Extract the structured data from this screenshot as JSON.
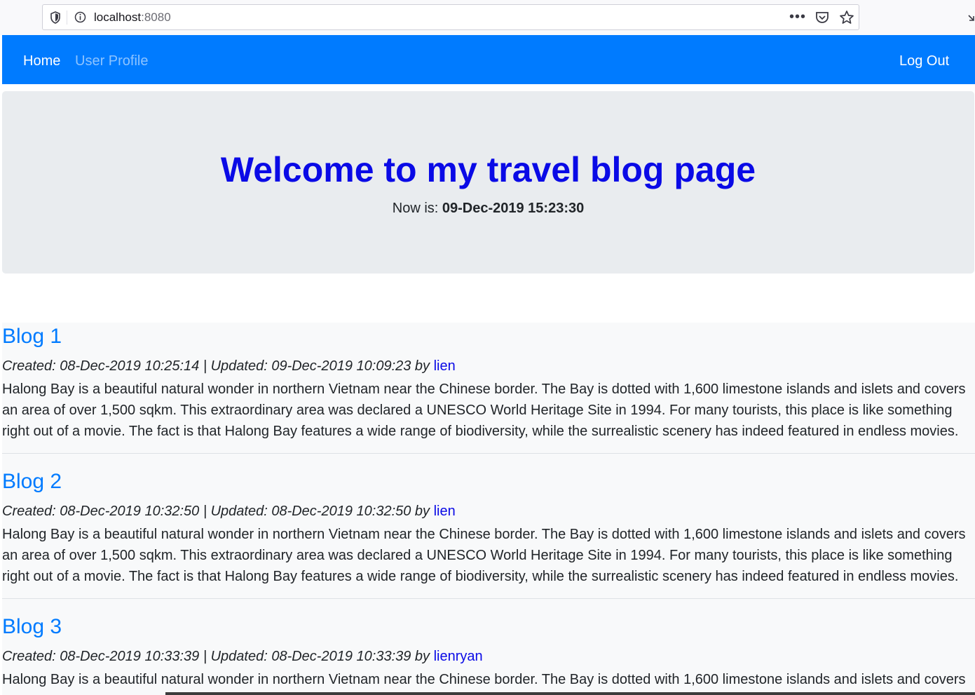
{
  "browser": {
    "url_host": "localhost",
    "url_port": ":8080",
    "more_label": "•••"
  },
  "navbar": {
    "home_label": "Home",
    "profile_label": "User Profile",
    "logout_label": "Log Out",
    "background": "#007bff"
  },
  "jumbotron": {
    "title": "Welcome to my travel blog page",
    "now_label": "Now is: ",
    "now_value": "09-Dec-2019 15:23:30"
  },
  "blogs": [
    {
      "title": "Blog 1",
      "meta": "Created: 08-Dec-2019 10:25:14 | Updated: 09-Dec-2019 10:09:23 by ",
      "author": "lien",
      "body": "Halong Bay is a beautiful natural wonder in northern Vietnam near the Chinese border. The Bay is dotted with 1,600 limestone islands and islets and covers an area of over 1,500 sqkm. This extraordinary area was declared a UNESCO World Heritage Site in 1994. For many tourists, this place is like something right out of a movie. The fact is that Halong Bay features a wide range of biodiversity, while the surrealistic scenery has indeed featured in endless movies."
    },
    {
      "title": "Blog 2",
      "meta": "Created: 08-Dec-2019 10:32:50 | Updated: 08-Dec-2019 10:32:50 by ",
      "author": "lien",
      "body": "Halong Bay is a beautiful natural wonder in northern Vietnam near the Chinese border. The Bay is dotted with 1,600 limestone islands and islets and covers an area of over 1,500 sqkm. This extraordinary area was declared a UNESCO World Heritage Site in 1994. For many tourists, this place is like something right out of a movie. The fact is that Halong Bay features a wide range of biodiversity, while the surrealistic scenery has indeed featured in endless movies."
    },
    {
      "title": "Blog 3",
      "meta": "Created: 08-Dec-2019 10:33:39 | Updated: 08-Dec-2019 10:33:39 by ",
      "author": "lienryan",
      "body": "Halong Bay is a beautiful natural wonder in northern Vietnam near the Chinese border. The Bay is dotted with 1,600 limestone islands and islets and covers"
    }
  ]
}
